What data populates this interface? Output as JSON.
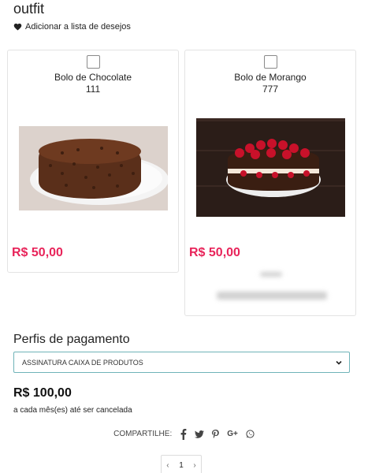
{
  "header": {
    "title": "outfit",
    "wishlist_label": "Adicionar a lista de desejos"
  },
  "products": [
    {
      "name": "Bolo de Chocolate",
      "code": "111",
      "price": "R$ 50,00",
      "image": "chocolate-cake-image"
    },
    {
      "name": "Bolo de Morango",
      "code": "777",
      "price": "R$ 50,00",
      "image": "strawberry-cake-image"
    }
  ],
  "payment": {
    "section_title": "Perfis de pagamento",
    "selected_profile": "ASSINATURA CAIXA DE PRODUTOS",
    "total": "R$ 100,00",
    "recurrence": "a cada mês(es) até ser cancelada"
  },
  "share": {
    "label": "COMPARTILHE:",
    "icons": [
      "facebook-icon",
      "twitter-icon",
      "pinterest-icon",
      "google-plus-icon",
      "whatsapp-icon"
    ]
  },
  "pagination": {
    "prev": "‹",
    "page": "1",
    "next": "›"
  }
}
